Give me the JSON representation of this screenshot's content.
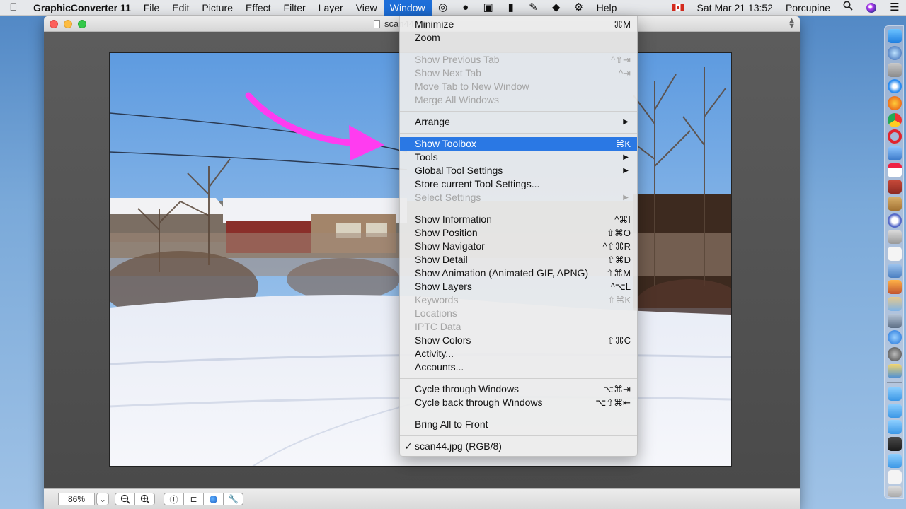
{
  "menubar": {
    "app_name": "GraphicConverter 11",
    "menus": [
      "File",
      "Edit",
      "Picture",
      "Effect",
      "Filter",
      "Layer",
      "View",
      "Window",
      "Help"
    ],
    "active_menu": "Window",
    "clock": "Sat Mar 21  13:52",
    "user": "Porcupine"
  },
  "window": {
    "title": "scan44.jpg",
    "zoom": "86%"
  },
  "window_menu": {
    "items": [
      {
        "label": "Minimize",
        "shortcut": "⌘M"
      },
      {
        "label": "Zoom",
        "shortcut": ""
      },
      {
        "label": "Show Previous Tab",
        "shortcut": "^⇧⇥",
        "disabled": true
      },
      {
        "label": "Show Next Tab",
        "shortcut": "^⇥",
        "disabled": true
      },
      {
        "label": "Move Tab to New Window",
        "shortcut": "",
        "disabled": true
      },
      {
        "label": "Merge All Windows",
        "shortcut": "",
        "disabled": true
      },
      {
        "label": "Arrange",
        "shortcut": "",
        "submenu": true
      },
      {
        "label": "Show Toolbox",
        "shortcut": "⌘K",
        "highlighted": true
      },
      {
        "label": "Tools",
        "shortcut": "",
        "submenu": true
      },
      {
        "label": "Global Tool Settings",
        "shortcut": "",
        "submenu": true
      },
      {
        "label": "Store current Tool Settings...",
        "shortcut": ""
      },
      {
        "label": "Select Settings",
        "shortcut": "",
        "submenu": true,
        "disabled": true
      },
      {
        "label": "Show Information",
        "shortcut": "^⌘I"
      },
      {
        "label": "Show Position",
        "shortcut": "⇧⌘O"
      },
      {
        "label": "Show Navigator",
        "shortcut": "^⇧⌘R"
      },
      {
        "label": "Show Detail",
        "shortcut": "⇧⌘D"
      },
      {
        "label": "Show Animation (Animated GIF, APNG)",
        "shortcut": "⇧⌘M"
      },
      {
        "label": "Show Layers",
        "shortcut": "^⌥L"
      },
      {
        "label": "Keywords",
        "shortcut": "⇧⌘K",
        "disabled": true
      },
      {
        "label": "Locations",
        "shortcut": "",
        "disabled": true
      },
      {
        "label": "IPTC Data",
        "shortcut": "",
        "disabled": true
      },
      {
        "label": "Show Colors",
        "shortcut": "⇧⌘C"
      },
      {
        "label": "Activity...",
        "shortcut": ""
      },
      {
        "label": "Accounts...",
        "shortcut": ""
      },
      {
        "label": "Cycle through Windows",
        "shortcut": "⌥⌘⇥"
      },
      {
        "label": "Cycle back through Windows",
        "shortcut": "⌥⇧⌘⇤"
      },
      {
        "label": "Bring All to Front",
        "shortcut": ""
      },
      {
        "label": "scan44.jpg (RGB/8)",
        "shortcut": "",
        "checked": true
      }
    ]
  },
  "colors": {
    "accent": "#2a78e4",
    "annotation_arrow": "#ff3cf0"
  }
}
